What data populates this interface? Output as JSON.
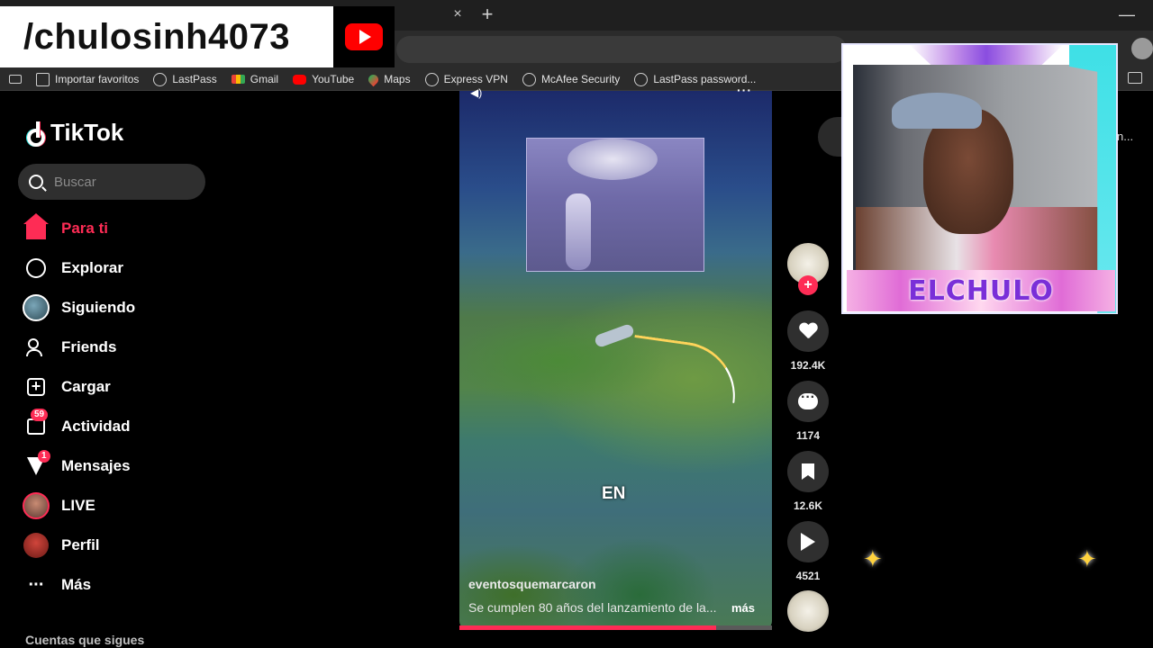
{
  "overlay": {
    "channel_handle": "/chulosinh4073",
    "webcam_banner": "ELCHULO"
  },
  "browser": {
    "tab_close": "×",
    "new_tab": "+",
    "minimize": "—",
    "bookmarks": [
      {
        "label": "Importar favoritos",
        "icon": "import-icon"
      },
      {
        "label": "LastPass",
        "icon": "globe-icon"
      },
      {
        "label": "Gmail",
        "icon": "gmail-icon"
      },
      {
        "label": "YouTube",
        "icon": "youtube-icon"
      },
      {
        "label": "Maps",
        "icon": "maps-icon"
      },
      {
        "label": "Express VPN",
        "icon": "globe-icon"
      },
      {
        "label": "McAfee Security",
        "icon": "globe-icon"
      },
      {
        "label": "LastPass password...",
        "icon": "globe-icon"
      }
    ],
    "right_partial_text": "n..."
  },
  "tiktok": {
    "logo": "TikTok",
    "search": {
      "placeholder": "Buscar",
      "value": ""
    },
    "nav": [
      {
        "label": "Para ti",
        "icon": "home-icon",
        "active": true
      },
      {
        "label": "Explorar",
        "icon": "compass-icon"
      },
      {
        "label": "Siguiendo",
        "icon": "following-avatar-icon"
      },
      {
        "label": "Friends",
        "icon": "friends-icon"
      },
      {
        "label": "Cargar",
        "icon": "upload-icon"
      },
      {
        "label": "Actividad",
        "icon": "activity-icon",
        "badge": "59"
      },
      {
        "label": "Mensajes",
        "icon": "message-icon",
        "badge": "1"
      },
      {
        "label": "LIVE",
        "icon": "live-avatar-icon"
      },
      {
        "label": "Perfil",
        "icon": "profile-avatar-icon"
      },
      {
        "label": "Más",
        "icon": "more-icon"
      }
    ],
    "footer_title": "Cuentas que sigues",
    "accent": "#fe2c55",
    "video": {
      "caption_overlay": "EN",
      "username": "eventosquemarcaron",
      "description": "Se cumplen 80 años del lanzamiento de la...",
      "more": "más",
      "progress": 0.82
    },
    "actions": {
      "likes": "192.4K",
      "comments": "1174",
      "saves": "12.6K",
      "shares": "4521",
      "follow": "+"
    }
  }
}
